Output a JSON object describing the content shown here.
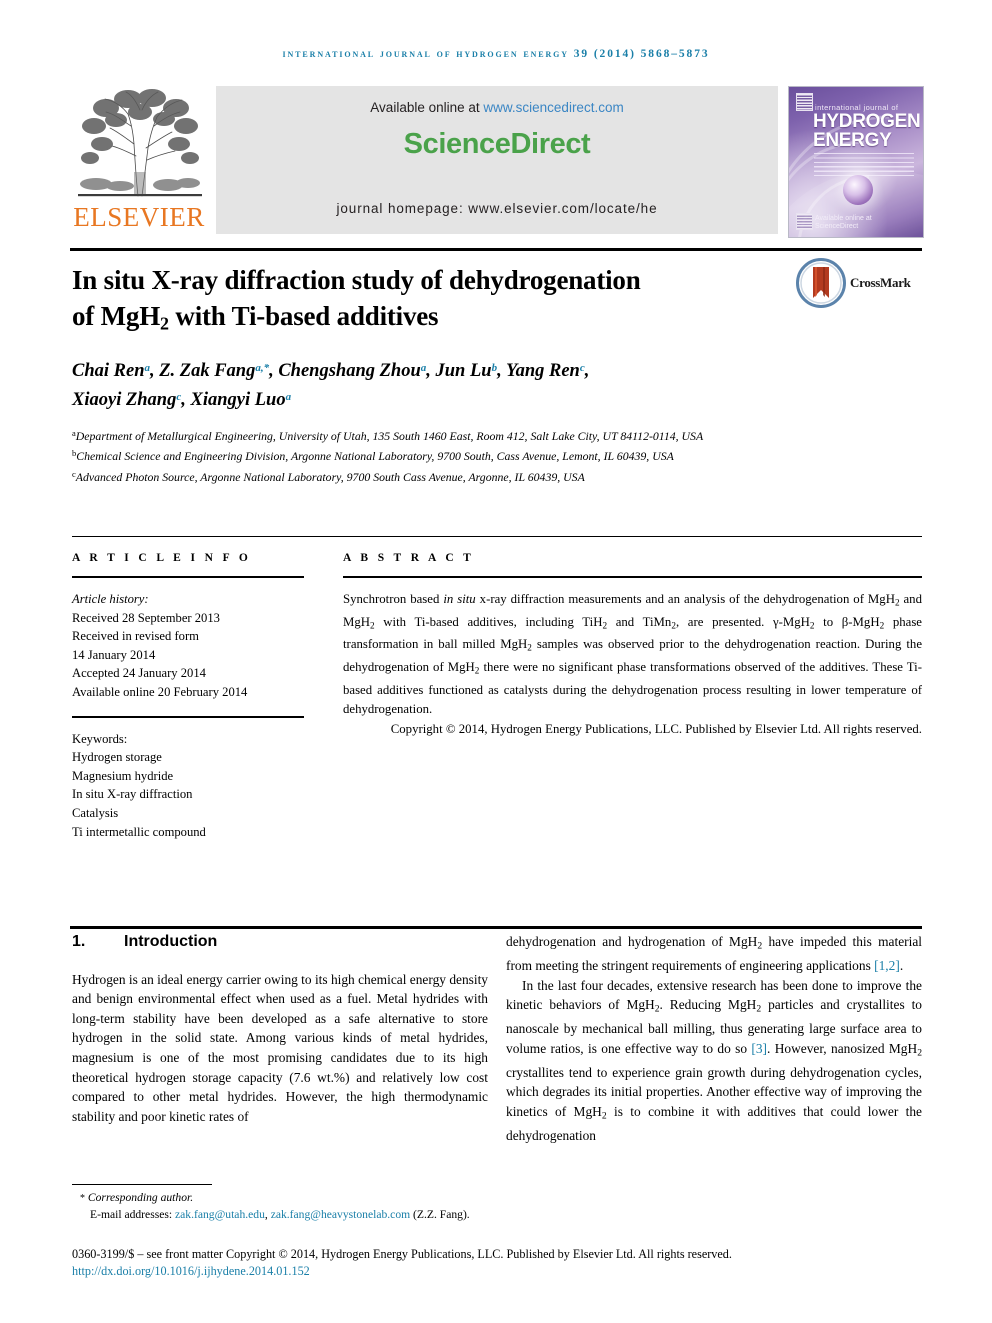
{
  "running_head": "international journal of hydrogen energy 39 (2014) 5868–5873",
  "masthead": {
    "publisher_name": "ELSEVIER",
    "available_online_label": "Available online at",
    "sciencedirect_url": "www.sciencedirect.com",
    "sciencedirect_logo": "ScienceDirect",
    "journal_homepage": "journal homepage: www.elsevier.com/locate/he",
    "cover": {
      "line1": "international journal of",
      "line2": "HYDROGEN",
      "line3": "ENERGY",
      "sciencedirect_note": "Available online at ScienceDirect"
    },
    "colors": {
      "link_blue": "#3b86c4",
      "sciencedirect_green": "#4aa24a",
      "elsevier_orange": "#E87722",
      "running_head_blue": "#1a7fa8"
    }
  },
  "article": {
    "title_line1": "In situ X-ray diffraction study of dehydrogenation",
    "title_line2_pre": "of MgH",
    "title_line2_sub": "2",
    "title_line2_post": " with Ti-based additives",
    "crossmark_label": "CrossMark",
    "authors": [
      {
        "name": "Chai Ren",
        "marks": "a",
        "sep": ", "
      },
      {
        "name": "Z. Zak Fang",
        "marks": "a,*",
        "sep": ", "
      },
      {
        "name": "Chengshang Zhou",
        "marks": "a",
        "sep": ", "
      },
      {
        "name": "Jun Lu",
        "marks": "b",
        "sep": ", "
      },
      {
        "name": "Yang Ren",
        "marks": "c",
        "sep": ", "
      },
      {
        "name": "Xiaoyi Zhang",
        "marks": "c",
        "sep": ", "
      },
      {
        "name": "Xiangyi Luo",
        "marks": "a",
        "sep": ""
      }
    ],
    "affiliations": [
      {
        "mark": "a",
        "text": "Department of Metallurgical Engineering, University of Utah, 135 South 1460 East, Room 412, Salt Lake City, UT 84112-0114, USA"
      },
      {
        "mark": "b",
        "text": "Chemical Science and Engineering Division, Argonne National Laboratory, 9700 South, Cass Avenue, Lemont, IL 60439, USA"
      },
      {
        "mark": "c",
        "text": "Advanced Photon Source, Argonne National Laboratory, 9700 South Cass Avenue, Argonne, IL 60439, USA"
      }
    ]
  },
  "article_info": {
    "heading": "A R T I C L E   I N F O",
    "history_label": "Article history:",
    "history": [
      "Received 28 September 2013",
      "Received in revised form",
      "14 January 2014",
      "Accepted 24 January 2014",
      "Available online 20 February 2014"
    ],
    "keywords_label": "Keywords:",
    "keywords": [
      "Hydrogen storage",
      "Magnesium hydride",
      "In situ X-ray diffraction",
      "Catalysis",
      "Ti intermetallic compound"
    ]
  },
  "abstract": {
    "heading": "A B S T R A C T",
    "copyright": "Copyright © 2014, Hydrogen Energy Publications, LLC. Published by Elsevier Ltd. All rights reserved."
  },
  "body": {
    "section_number": "1.",
    "section_title": "Introduction",
    "left_paragraph": "Hydrogen is an ideal energy carrier owing to its high chemical energy density and benign environmental effect when used as a fuel. Metal hydrides with long-term stability have been developed as a safe alternative to store hydrogen in the solid state. Among various kinds of metal hydrides, magnesium is one of the most promising candidates due to its high theoretical hydrogen storage capacity (7.6 wt.%) and relatively low cost compared to other metal hydrides. However, the high thermodynamic stability and poor kinetic rates of",
    "right_ref_1": "[1,2]",
    "right_ref_2": "[3]"
  },
  "footer": {
    "corresponding_marker": "*",
    "corresponding_label": "Corresponding author.",
    "email_label": "E-mail addresses:",
    "email1": "zak.fang@utah.edu",
    "email_sep": ", ",
    "email2": "zak.fang@heavystonelab.com",
    "email_suffix": " (Z.Z. Fang).",
    "copyright_line": "0360-3199/$ – see front matter Copyright © 2014, Hydrogen Energy Publications, LLC. Published by Elsevier Ltd. All rights reserved.",
    "doi": "http://dx.doi.org/10.1016/j.ijhydene.2014.01.152"
  }
}
